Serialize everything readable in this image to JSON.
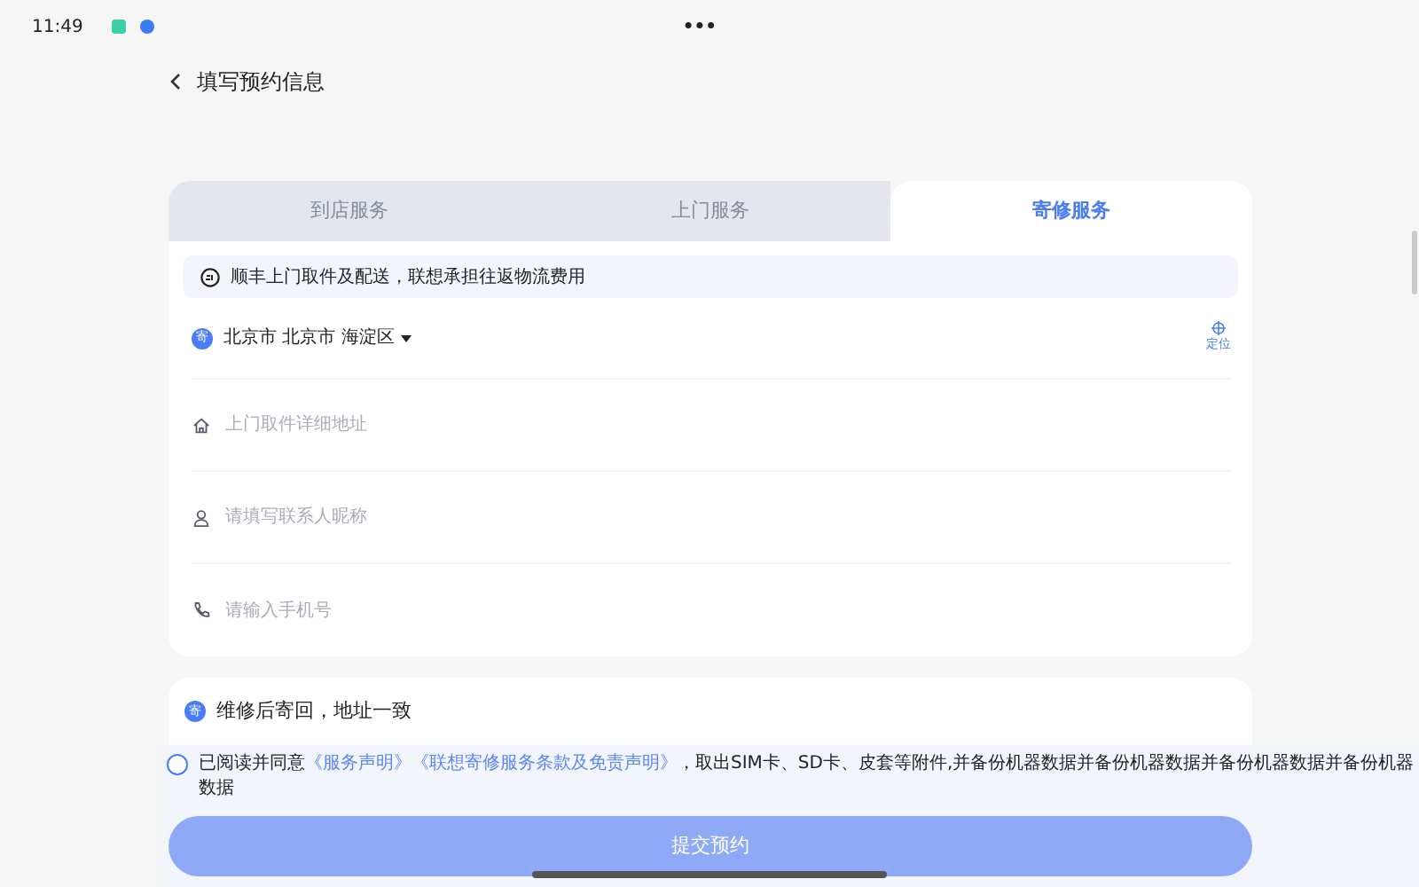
{
  "status_bar": {
    "time": "11:49",
    "more": "•••"
  },
  "header": {
    "title": "填写预约信息"
  },
  "tabs": [
    {
      "label": "到店服务",
      "selected": false
    },
    {
      "label": "上门服务",
      "selected": false
    },
    {
      "label": "寄修服务",
      "selected": true
    }
  ],
  "notice": "顺丰上门取件及配送，联想承担往返物流费用",
  "region": {
    "badge": "寄",
    "value": "北京市 北京市 海淀区",
    "locate": "定位"
  },
  "fields": [
    {
      "kind": "home",
      "placeholder": "上门取件详细地址"
    },
    {
      "kind": "person",
      "placeholder": "请填写联系人昵称"
    },
    {
      "kind": "phone",
      "placeholder": "请输入手机号"
    }
  ],
  "return_option": {
    "badge": "寄",
    "text": "维修后寄回，地址一致"
  },
  "agreement": {
    "checked": false,
    "prefix": "已阅读并同意",
    "links": [
      "《服务声明》",
      "《联想寄修服务条款及免责声明》"
    ],
    "suffix": "，取出SIM卡、SD卡、皮套等附件,并备份机器数据并备份机器数据并备份机器数据并备份机器数据"
  },
  "submit": {
    "label": "提交预约",
    "disabled": true
  }
}
